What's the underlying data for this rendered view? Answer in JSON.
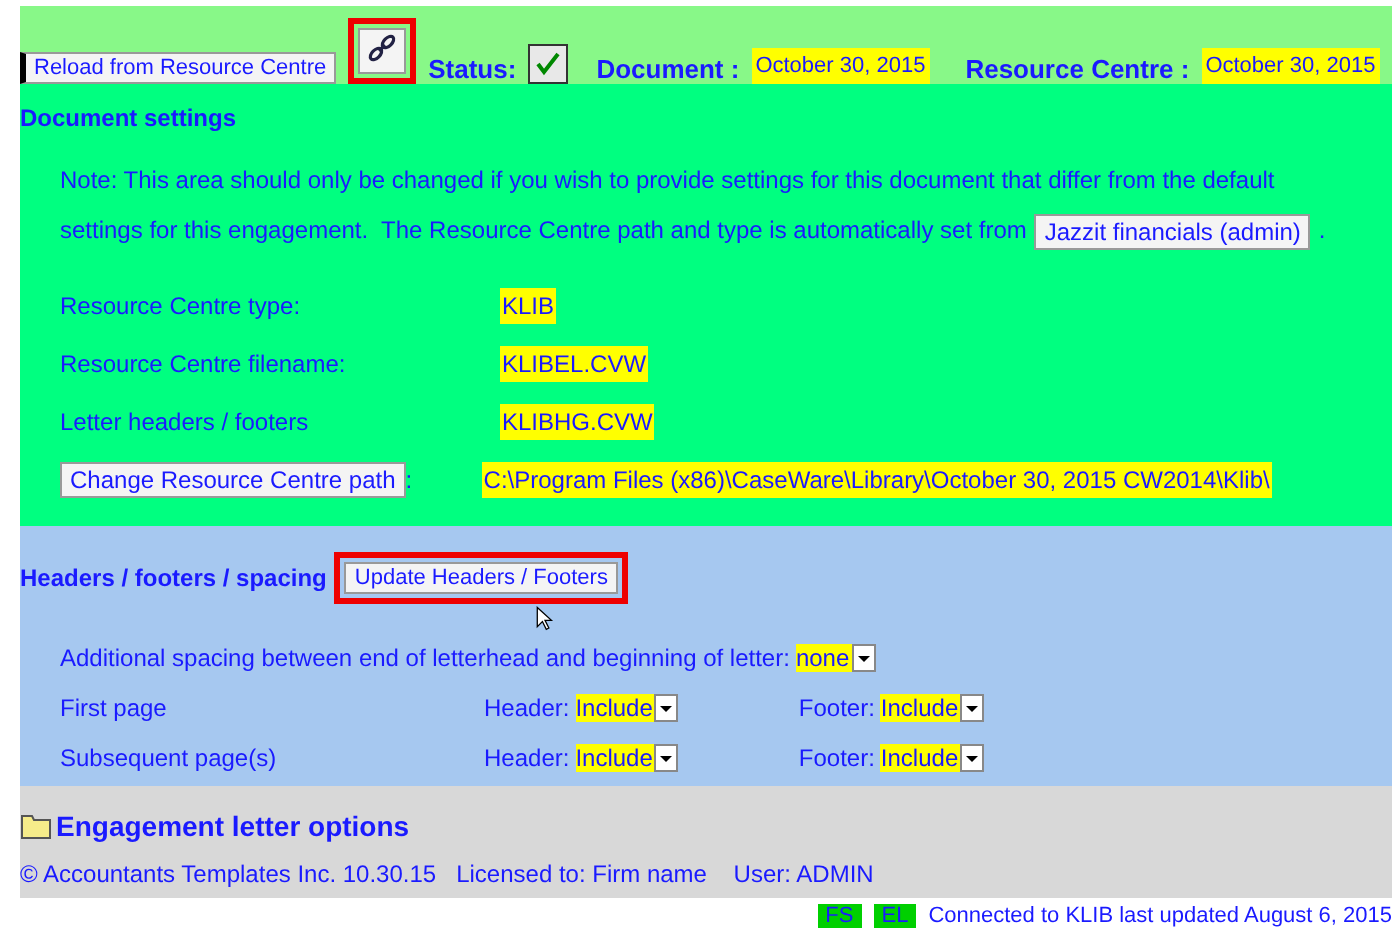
{
  "top_bar": {
    "reload_button": "Reload from Resource Centre",
    "link_button": {
      "highlighted": true
    },
    "status_label": "Status:",
    "status_checked": true,
    "document_label": "Document :",
    "document_date": "October 30, 2015",
    "resource_label": "Resource Centre :",
    "resource_date": "October 30, 2015"
  },
  "document_settings": {
    "title": "Document settings",
    "note": "Note: This area should only be changed if you wish to provide settings for this document that differ from the default",
    "note_line2": "settings for this engagement.  The Resource Centre path and type is automatically set from",
    "note_button": "Jazzit financials (admin)",
    "note_end": ".",
    "rows": [
      {
        "label": "Resource Centre type:",
        "value": "KLIB"
      },
      {
        "label": "Resource Centre filename:",
        "value": "KLIBEL.CVW"
      },
      {
        "label": "Letter headers / footers",
        "value": "KLIBHG.CVW"
      }
    ],
    "path_button": "Change Resource Centre path",
    "path_colon": ":",
    "path_value": "C:\\Program Files (x86)\\CaseWare\\Library\\October 30, 2015 CW2014\\Klib\\"
  },
  "headers": {
    "title": "Headers / footers / spacing",
    "update_button": {
      "label": "Update Headers / Footers",
      "highlighted": true
    },
    "spacing_label": "Additional spacing between end of letterhead and beginning of letter:",
    "spacing_value": "none",
    "pages": [
      {
        "label": "First page",
        "header_label": "Header:",
        "header": "Include",
        "footer_label": "Footer:",
        "footer": "Include"
      },
      {
        "label": "Subsequent page(s)",
        "header_label": "Header:",
        "header": "Include",
        "footer_label": "Footer:",
        "footer": "Include"
      }
    ]
  },
  "engagement": {
    "title": "Engagement letter options",
    "footer": "© Accountants Templates Inc. 10.30.15   Licensed to: Firm name    User: ADMIN"
  },
  "status_bar": {
    "badges": [
      "FS",
      "EL"
    ],
    "text": "Connected to KLIB last updated August 6, 2015"
  }
}
